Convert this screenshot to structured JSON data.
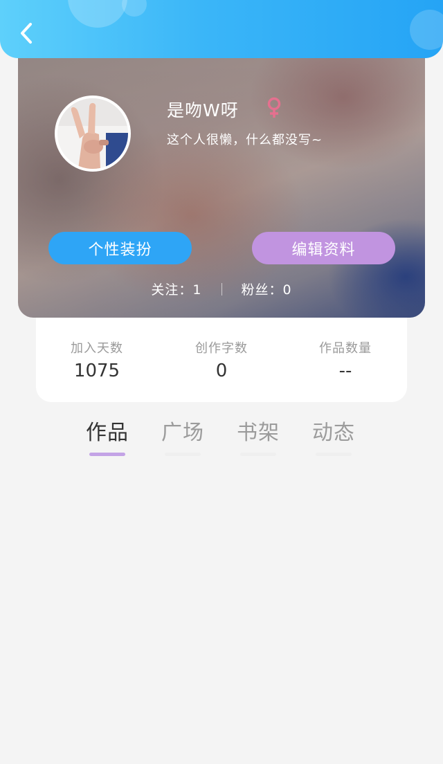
{
  "header": {
    "back_icon": "chevron-left-icon",
    "accent_color": "#2ea5f6"
  },
  "profile": {
    "username": "是吻W呀",
    "gender_icon": "female-icon",
    "gender_color": "#e5708f",
    "bio": "这个人很懒，什么都没写~",
    "buttons": {
      "dress_up": "个性装扮",
      "edit_profile": "编辑资料"
    },
    "follow": {
      "following": "关注：1",
      "followers": "粉丝：0"
    }
  },
  "stats": [
    {
      "label": "加入天数",
      "value": "1075"
    },
    {
      "label": "创作字数",
      "value": "0"
    },
    {
      "label": "作品数量",
      "value": "--"
    }
  ],
  "tabs": [
    {
      "label": "作品",
      "active": true
    },
    {
      "label": "广场",
      "active": false
    },
    {
      "label": "书架",
      "active": false
    },
    {
      "label": "动态",
      "active": false
    }
  ]
}
